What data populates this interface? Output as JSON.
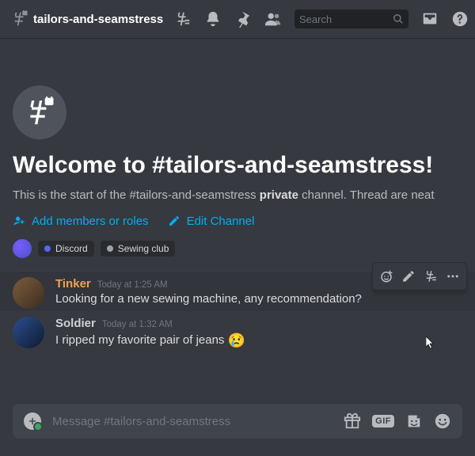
{
  "header": {
    "channel": "tailors-and-seamstress",
    "search_placeholder": "Search"
  },
  "welcome": {
    "title": "Welcome to #tailors-and-seamstress!",
    "subtitle_pre": "This is the start of the #tailors-and-seamstress ",
    "subtitle_bold": "private",
    "subtitle_post": " channel. Thread are neat",
    "add_members": "Add members or roles",
    "edit_channel": "Edit Channel",
    "chips": {
      "discord": "Discord",
      "sewing": "Sewing club"
    }
  },
  "messages": [
    {
      "user": "Tinker",
      "ts": "Today at 1:25 AM",
      "text": "Looking for a new sewing machine, any recommendation?"
    },
    {
      "user": "Soldier",
      "ts": "Today at 1:32 AM",
      "text": "I ripped my favorite pair of jeans ",
      "emoji": "😢"
    }
  ],
  "input": {
    "placeholder": "Message #tailors-and-seamstress",
    "gif": "GIF"
  }
}
